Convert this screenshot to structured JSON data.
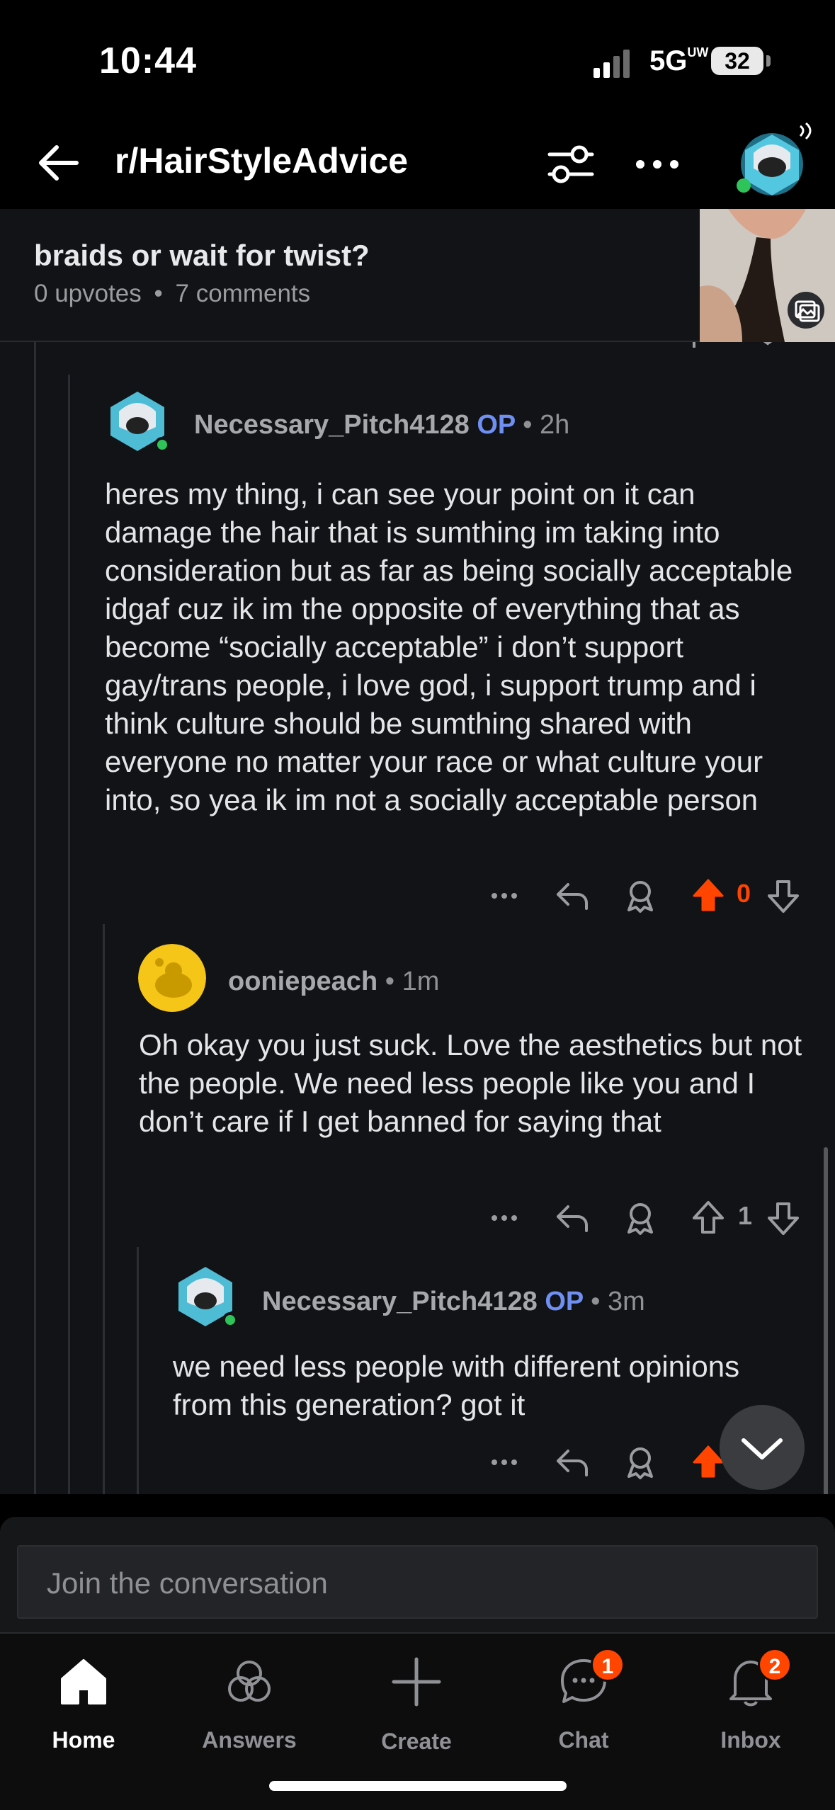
{
  "status_bar": {
    "time": "10:44",
    "network": "5G",
    "network_sup": "UW",
    "battery": "32"
  },
  "header": {
    "subreddit": "r/HairStyleAdvice"
  },
  "post": {
    "title": "braids or wait for twist?",
    "upvotes": "0 upvotes",
    "separator": "•",
    "comments": "7 comments"
  },
  "comments": [
    {
      "author": "Necessary_Pitch4128",
      "op": "OP",
      "separator": "•",
      "time": "2h",
      "body": "heres my thing, i can see your point on it can damage the hair that is sumthing im taking into consideration but as far as being socially acceptable idgaf cuz ik im the opposite of everything that as become “socially acceptable” i don’t support gay/trans people, i love god, i support trump and i think culture should be sumthing shared with everyone no matter your race or what culture your into, so yea ik im not a socially acceptable person",
      "score": "0",
      "upvoted": true
    },
    {
      "author": "ooniepeach",
      "op": "",
      "separator": "•",
      "time": "1m",
      "body": "Oh okay you just suck. Love the aesthetics but not the people. We need less people like you and I don’t care if I get banned for saying that",
      "score": "1",
      "upvoted": false
    },
    {
      "author": "Necessary_Pitch4128",
      "op": "OP",
      "separator": "•",
      "time": "3m",
      "body": "we need less people with different opinions from this generation? got it",
      "score": "",
      "upvoted": true
    }
  ],
  "composer": {
    "placeholder": "Join the conversation"
  },
  "tabs": [
    {
      "label": "Home",
      "icon": "home-icon",
      "active": true,
      "badge": ""
    },
    {
      "label": "Answers",
      "icon": "answers-icon",
      "active": false,
      "badge": ""
    },
    {
      "label": "Create",
      "icon": "plus-icon",
      "active": false,
      "badge": ""
    },
    {
      "label": "Chat",
      "icon": "chat-icon",
      "active": false,
      "badge": "1"
    },
    {
      "label": "Inbox",
      "icon": "bell-icon",
      "active": false,
      "badge": "2"
    }
  ],
  "colors": {
    "upvote_active": "#ff4500",
    "op": "#6f8ff2",
    "online": "#2ec45a",
    "bg": "#121316"
  }
}
